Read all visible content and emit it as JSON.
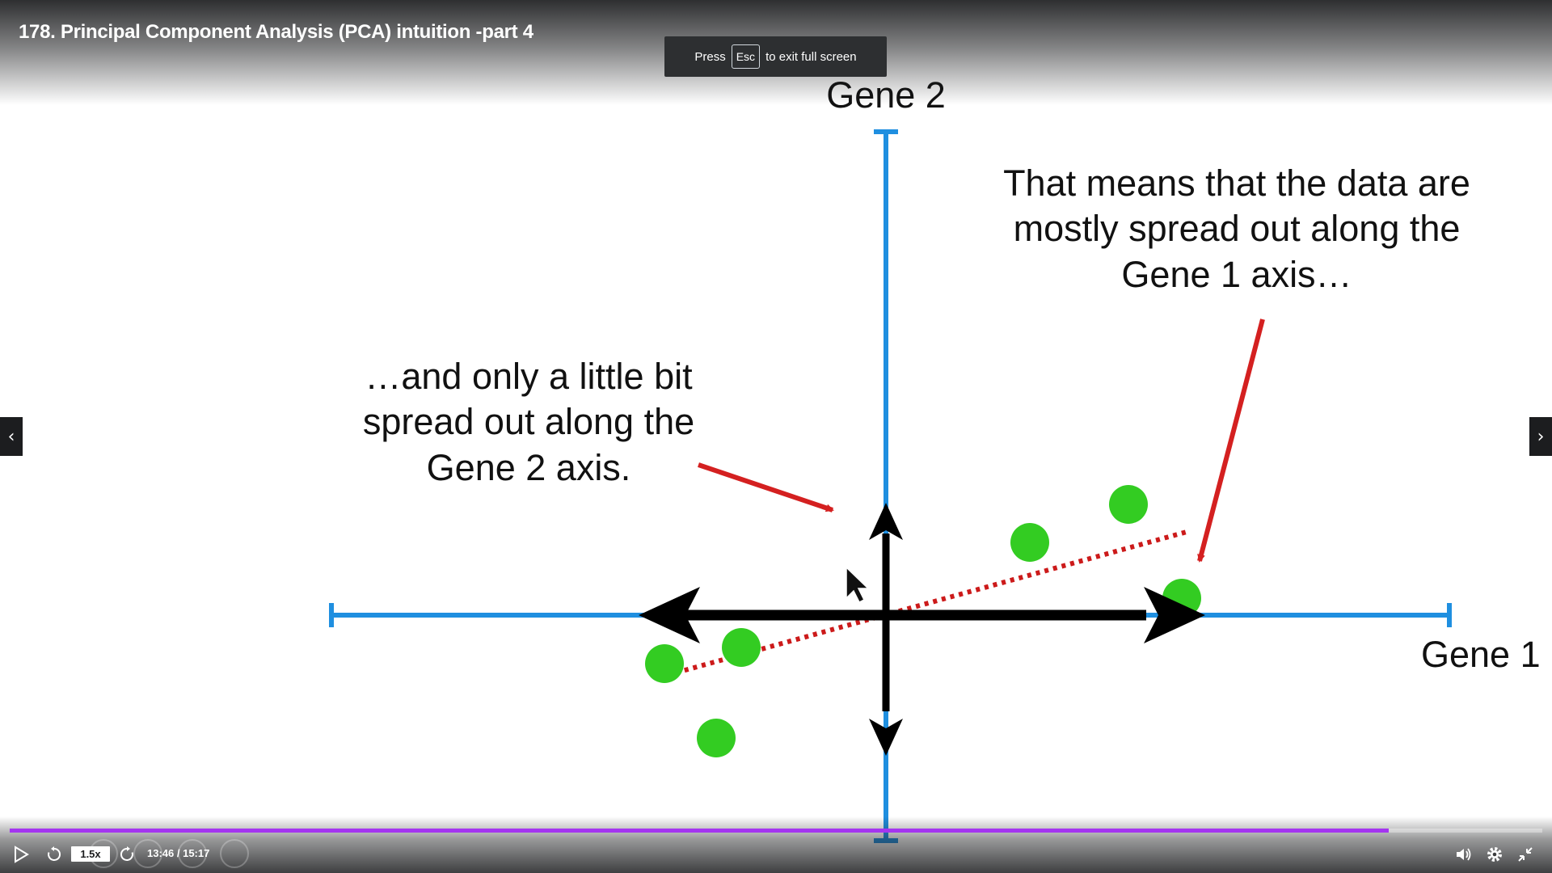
{
  "window": {
    "title": "178. Principal Component Analysis (PCA) intuition -part 4"
  },
  "fullscreen_toast": {
    "prefix": "Press",
    "key": "Esc",
    "suffix": "to exit full screen"
  },
  "slide": {
    "y_axis_label": "Gene 2",
    "x_axis_label": "Gene 1",
    "annotation_right": [
      "That means that the data are",
      "mostly spread out along the",
      "Gene 1 axis…"
    ],
    "annotation_left": [
      "…and only a little bit",
      "spread out along the",
      "Gene 2 axis."
    ],
    "colors": {
      "axis": "#1f8fe0",
      "points": "#33cc22",
      "arrows": "#000000",
      "annotation_arrows": "#d42020",
      "dotted_line": "#cc1a1a"
    }
  },
  "player": {
    "speed": "1.5x",
    "time": "13:46 / 15:17",
    "progress_fraction": 0.9,
    "accent_color": "#a435f0",
    "icons": [
      "play-icon",
      "rewind-icon",
      "forward-icon",
      "volume-icon",
      "settings-icon",
      "exit-fullscreen-icon"
    ]
  },
  "navigation": {
    "prev_icon": "‹",
    "next_icon": "›"
  }
}
